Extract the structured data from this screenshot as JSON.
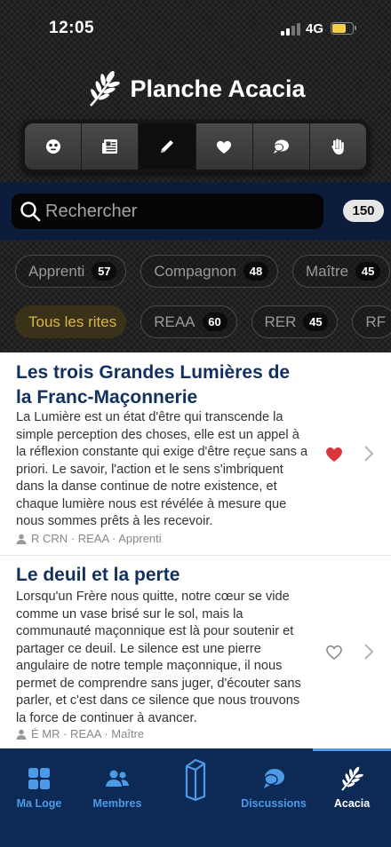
{
  "status_bar": {
    "time": "12:05",
    "network": "4G"
  },
  "app_title": "Planche Acacia",
  "toolbar": {
    "items": [
      {
        "icon": "smiley-icon",
        "active": false
      },
      {
        "icon": "newspaper-icon",
        "active": false
      },
      {
        "icon": "pencil-icon",
        "active": true
      },
      {
        "icon": "heart-icon",
        "active": false
      },
      {
        "icon": "chat-icon",
        "active": false
      },
      {
        "icon": "hand-icon",
        "active": false
      }
    ]
  },
  "search": {
    "placeholder": "Rechercher",
    "value": "",
    "count": "150"
  },
  "grade_filters": [
    {
      "label": "Apprenti",
      "count": "57"
    },
    {
      "label": "Compagnon",
      "count": "48"
    },
    {
      "label": "Maître",
      "count": "45"
    }
  ],
  "rite_filters": [
    {
      "label": "Tous les rites",
      "selected": true
    },
    {
      "label": "REAA",
      "count": "60"
    },
    {
      "label": "RER",
      "count": "45"
    },
    {
      "label": "RF",
      "count": ""
    }
  ],
  "articles": [
    {
      "title": "Les trois Grandes Lumières de la Franc-Maçonnerie",
      "body": "La Lumière est un état d'être qui transcende la simple perception des choses, elle est un appel à la réflexion constante qui exige d'être reçue sans a priori. Le savoir, l'action et le sens s'imbriquent dans la danse continue de notre existence, et chaque lumière nous est révélée à mesure que nous sommes prêts à les recevoir.",
      "meta": "R CRN · REAA · Apprenti",
      "liked": true
    },
    {
      "title": "Le deuil et la perte",
      "body": "Lorsqu'un Frère nous quitte, notre cœur se vide comme un vase brisé sur le sol, mais la communauté maçonnique est là pour soutenir et partager ce deuil. Le silence est une pierre angulaire de notre temple maçonnique, il nous permet de comprendre sans juger, d'écouter sans parler, et c'est dans ce silence que nous trouvons la force de continuer à avancer.",
      "meta": "É MR · REAA · Maître",
      "liked": false
    }
  ],
  "bottom_nav": [
    {
      "label": "Ma Loge",
      "icon": "grid-icon"
    },
    {
      "label": "Membres",
      "icon": "members-icon"
    },
    {
      "label": "",
      "icon": "pillar-icon"
    },
    {
      "label": "Discussions",
      "icon": "discussions-icon"
    },
    {
      "label": "Acacia",
      "icon": "acacia-icon",
      "active": true
    }
  ],
  "colors": {
    "nav_background": "#0d2a57",
    "nav_accent": "#4c9be8",
    "title_blue": "#12305f",
    "liked_red": "#d9363e",
    "chip_gold": "#d8b44a"
  }
}
